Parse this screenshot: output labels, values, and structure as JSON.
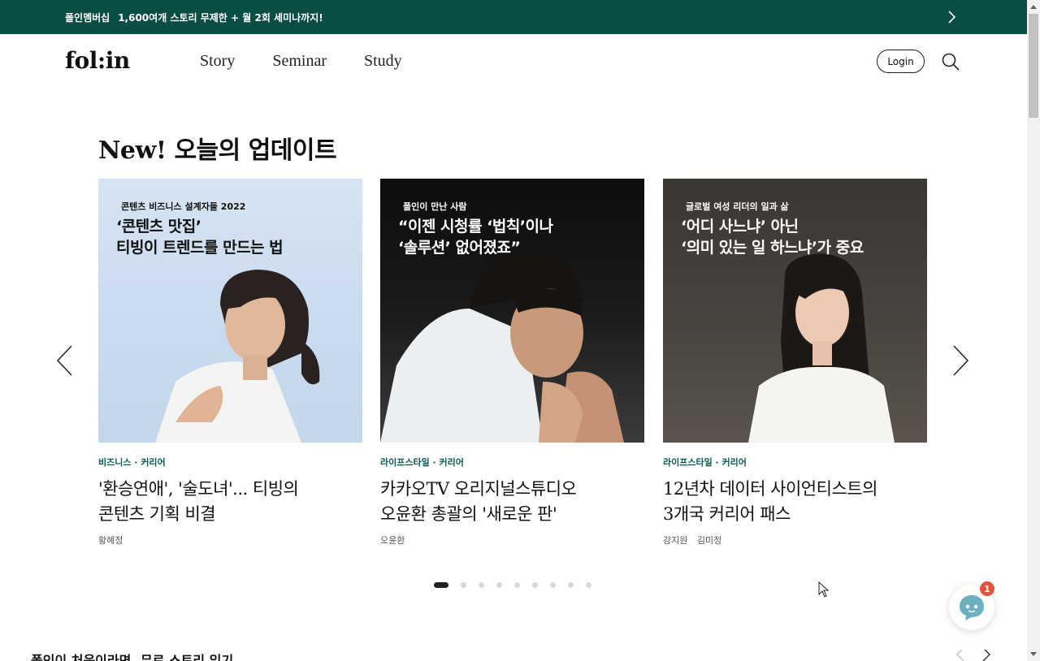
{
  "banner": {
    "strong": "폴인멤버십",
    "text": "1,600여개 스토리 무제한 + 월 2회 세미나까지!"
  },
  "header": {
    "logo": "fol:in",
    "nav": [
      "Story",
      "Seminar",
      "Study"
    ],
    "login": "Login"
  },
  "section": {
    "title": "New! 오늘의 업데이트"
  },
  "cards": [
    {
      "series": "콘텐츠 비즈니스 설계자들 2022",
      "headline_1": "‘콘텐츠 맛집’",
      "headline_2": "티빙이 트렌드를 만드는 법",
      "category": "비즈니스 · 커리어",
      "title_1": "'환승연애', '술도녀'... 티빙의",
      "title_2": "콘텐츠 기획 비결",
      "authors": [
        "황혜정"
      ]
    },
    {
      "series": "폴인이 만난 사람",
      "headline_1": "“이젠 시청률 ‘법칙’이나",
      "headline_2": "‘솔루션’ 없어졌죠”",
      "category": "라이프스타일 · 커리어",
      "title_1": "카카오TV 오리지널스튜디오",
      "title_2": "오윤환 총괄의 '새로운 판'",
      "authors": [
        "오윤환"
      ]
    },
    {
      "series": "글로벌 여성 리더의 일과 삶",
      "headline_1": "‘어디 사느냐’ 아닌",
      "headline_2": "‘의미 있는 일 하느냐’가 중요",
      "category": "라이프스타일 · 커리어",
      "title_1": "12년차 데이터 사이언티스트의",
      "title_2": "3개국 커리어 패스",
      "authors": [
        "강지원",
        "김미정"
      ]
    }
  ],
  "carousel": {
    "dot_count": 9,
    "active_index": 0
  },
  "next_section": {
    "title": "폴인이 처음이라면, 무료 스토리 읽기"
  },
  "chat": {
    "badge": "1"
  },
  "colors": {
    "brand": "#0a4d44",
    "category": "#0a5a4e",
    "badge": "#e0523b",
    "chat_face": "#6ab0c0"
  },
  "icons": {
    "banner_arrow": "chevron-right-icon",
    "search": "search-icon",
    "prev": "chevron-left-icon",
    "next": "chevron-right-icon",
    "chat": "chat-bot-icon"
  }
}
